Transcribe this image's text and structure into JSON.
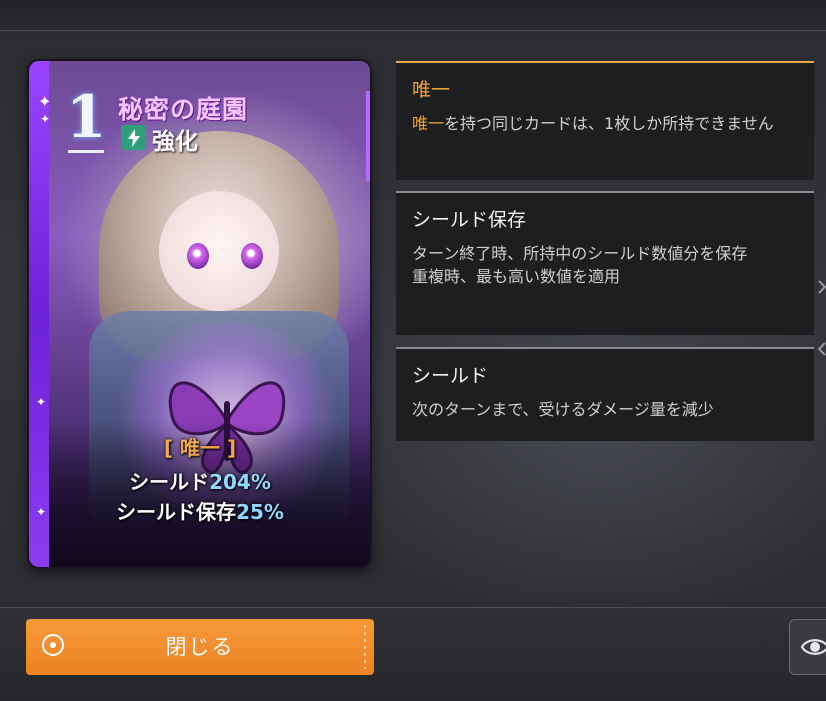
{
  "card": {
    "cost": "1",
    "title": "秘密の庭園",
    "type_label": "強化",
    "type_icon": "lightning-icon",
    "unique_tag": "[ 唯一 ]",
    "line1_prefix": "シールド",
    "line1_value": "204%",
    "line2_prefix": "シールド保存",
    "line2_value": "25%"
  },
  "keywords": [
    {
      "title": "唯一",
      "desc_keyword": "唯一",
      "desc": "を持つ同じカードは、1枚しか所持できません"
    },
    {
      "title": "シールド保存",
      "desc_line1": "ターン終了時、所持中のシールド数値分を保存",
      "desc_line2": "重複時、最も高い数値を適用"
    },
    {
      "title": "シールド",
      "desc": "次のターンまで、受けるダメージ量を減少"
    }
  ],
  "footer": {
    "close_label": "閉じる"
  },
  "colors": {
    "accent_orange": "#f0a23a",
    "button_orange": "#f08a2a",
    "value_blue": "#8fd8ff",
    "card_purple": "#8a3cf0"
  }
}
